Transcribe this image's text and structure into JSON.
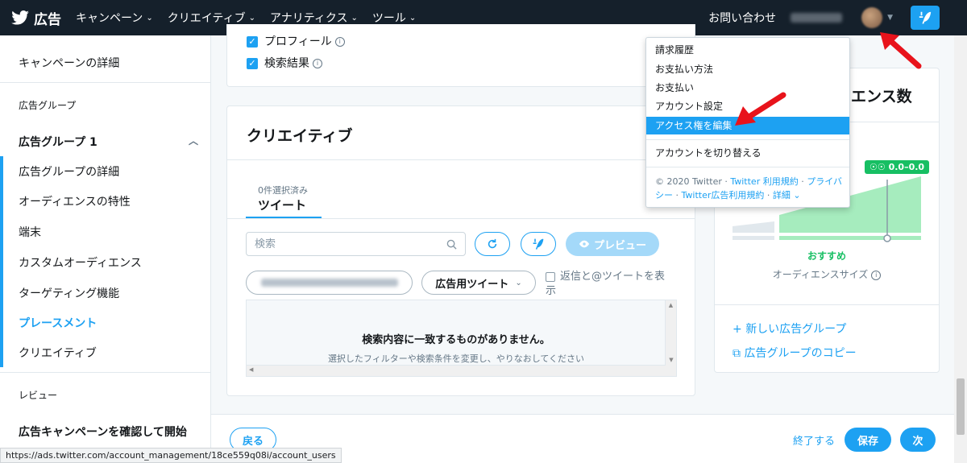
{
  "topnav": {
    "brand": "広告",
    "items": [
      {
        "label": "キャンペーン"
      },
      {
        "label": "クリエイティブ"
      },
      {
        "label": "アナリティクス"
      },
      {
        "label": "ツール"
      }
    ],
    "contact": "お問い合わせ"
  },
  "sidebar": {
    "campaign_details": "キャンペーンの詳細",
    "ad_groups_header": "広告グループ",
    "ad_group_1": "広告グループ 1",
    "items": [
      "広告グループの詳細",
      "オーディエンスの特性",
      "端末",
      "カスタムオーディエンス",
      "ターゲティング機能",
      "プレースメント",
      "クリエイティブ"
    ],
    "active_item": "プレースメント",
    "review_header": "レビュー",
    "launch": "広告キャンペーンを確認して開始"
  },
  "placement": {
    "profile": "プロフィール",
    "search_results": "検索結果"
  },
  "creative": {
    "title": "クリエイティブ",
    "selected_count": "0件選択済み",
    "tab": "ツイート",
    "search_placeholder": "検索",
    "preview": "プレビュー",
    "filter_type": "広告用ツイート",
    "show_replies": "返信と@ツイートを表示",
    "empty_title": "検索内容に一致するものがありません。",
    "empty_sub": "選択したフィルターや検索条件を変更し、やりなおしてください"
  },
  "audience": {
    "title_visible": "ィエンス数",
    "range": "0.0–0.0",
    "recommended": "おすすめ",
    "size_label": "オーディエンスサイズ",
    "new_group": "新しい広告グループ",
    "copy_group": "広告グループのコピー"
  },
  "footer": {
    "back": "戻る",
    "finish": "終了する",
    "save": "保存",
    "next": "次"
  },
  "dropdown": {
    "items": [
      "請求履歴",
      "お支払い方法",
      "お支払い",
      "アカウント設定",
      "アクセス権を編集"
    ],
    "highlighted": "アクセス権を編集",
    "switch_account": "アカウントを切り替える",
    "copyright": "© 2020 Twitter · ",
    "link1": "Twitter 利用規約",
    "sep1": " · ",
    "link2": "プライバシー",
    "sep2": " · ",
    "link3": "Twitter広告利用規約",
    "sep3": " · ",
    "link4": "詳細"
  },
  "status_url": "https://ads.twitter.com/account_management/18ce559q08i/account_users",
  "colors": {
    "brand_blue": "#1da1f2",
    "nav_bg": "#15202b",
    "green": "#17bf63",
    "arrow_red": "#e8131b"
  }
}
